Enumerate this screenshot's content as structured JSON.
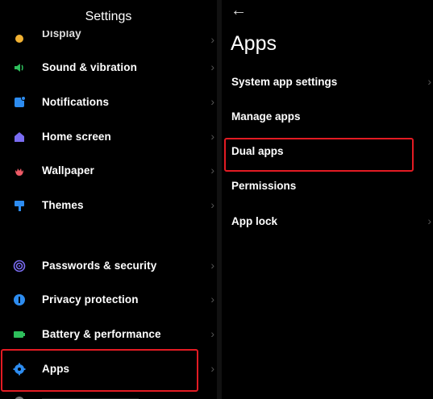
{
  "settings": {
    "title": "Settings",
    "items": [
      {
        "label": "Display",
        "icon": "display-icon",
        "color": "#f2b233"
      },
      {
        "label": "Sound & vibration",
        "icon": "speaker-icon",
        "color": "#2ebf5c"
      },
      {
        "label": "Notifications",
        "icon": "notifications-icon",
        "color": "#2d8cf0"
      },
      {
        "label": "Home screen",
        "icon": "home-icon",
        "color": "#7a6cf2"
      },
      {
        "label": "Wallpaper",
        "icon": "flower-icon",
        "color": "#ee5a66"
      },
      {
        "label": "Themes",
        "icon": "brush-icon",
        "color": "#2d8cf0"
      },
      {
        "label": "Passwords & security",
        "icon": "fingerprint-icon",
        "color": "#7a6cf2"
      },
      {
        "label": "Privacy protection",
        "icon": "shield-icon",
        "color": "#2d8cf0"
      },
      {
        "label": "Battery & performance",
        "icon": "battery-icon",
        "color": "#2ebf5c"
      },
      {
        "label": "Apps",
        "icon": "gear-icon",
        "color": "#2d8cf0"
      }
    ]
  },
  "apps_page": {
    "back": "←",
    "title": "Apps",
    "items": [
      {
        "label": "System app settings"
      },
      {
        "label": "Manage apps"
      },
      {
        "label": "Dual apps"
      },
      {
        "label": "Permissions"
      },
      {
        "label": "App lock"
      }
    ]
  },
  "highlight_color": "#e31b23"
}
